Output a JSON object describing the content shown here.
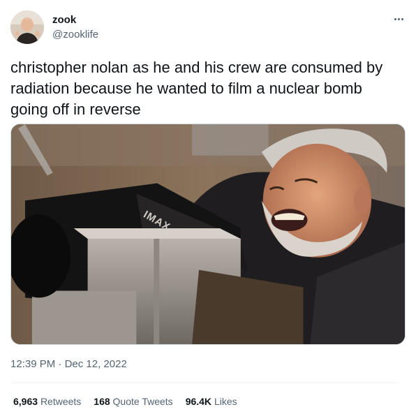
{
  "tweet": {
    "author_name": "zook",
    "author_handle": "@zooklife",
    "text": "christopher nolan as he and his crew are consumed by\nradiation because he wanted to film a nuclear bomb\ngoing off in reverse",
    "time": "12:39 PM",
    "separator": "·",
    "date": "Dec 12, 2022",
    "media_label": "IMAX"
  },
  "stats": {
    "retweets_count": "6,963",
    "retweets_label": "Retweets",
    "quotes_count": "168",
    "quotes_label": "Quote Tweets",
    "likes_count": "96.4K",
    "likes_label": "Likes"
  },
  "icons": {
    "more": "more-dots-icon"
  },
  "colors": {
    "text": "#0f1419",
    "secondary": "#536471",
    "border": "#cfd9de"
  }
}
